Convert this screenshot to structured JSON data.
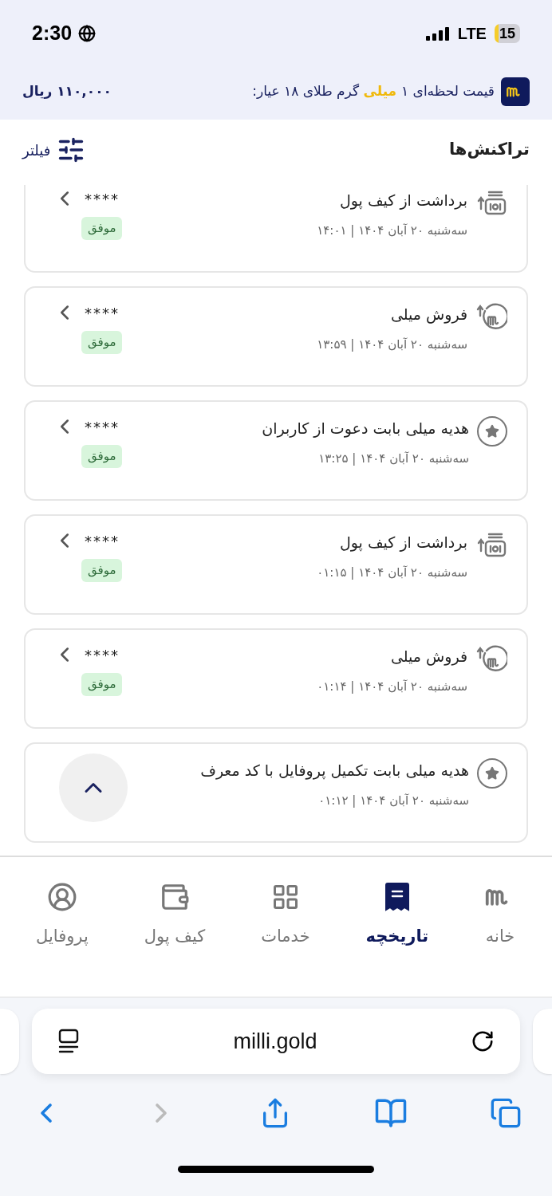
{
  "status_bar": {
    "time": "2:30",
    "network": "LTE",
    "battery": "15"
  },
  "price_banner": {
    "label_parts": [
      {
        "text": "قیمت لحظه‌ای ۱",
        "highlight": false
      },
      {
        "text": "میلی",
        "highlight": true
      },
      {
        "text": "گرم طلای ۱۸ عیار:",
        "highlight": false
      }
    ],
    "price": "۱۱۰,۰۰۰ ریال"
  },
  "header": {
    "title": "تراکنش‌ها",
    "filter": "فیلتر"
  },
  "transactions": [
    {
      "kind": "withdraw",
      "title": "برداشت از کیف پول",
      "date": "سه‌شنبه ۲۰ آبان ۱۴۰۴ | ۱۴:۰۱",
      "amount": "****",
      "status": "موفق"
    },
    {
      "kind": "sell",
      "title": "فروش میلی",
      "date": "سه‌شنبه ۲۰ آبان ۱۴۰۴ | ۱۳:۵۹",
      "amount": "****",
      "status": "موفق"
    },
    {
      "kind": "gift",
      "title": "هدیه میلی بابت دعوت از کاربران",
      "date": "سه‌شنبه ۲۰ آبان ۱۴۰۴ | ۱۳:۲۵",
      "amount": "****",
      "status": "موفق"
    },
    {
      "kind": "withdraw",
      "title": "برداشت از کیف پول",
      "date": "سه‌شنبه ۲۰ آبان ۱۴۰۴ | ۰۱:۱۵",
      "amount": "****",
      "status": "موفق"
    },
    {
      "kind": "sell",
      "title": "فروش میلی",
      "date": "سه‌شنبه ۲۰ آبان ۱۴۰۴ | ۰۱:۱۴",
      "amount": "****",
      "status": "موفق"
    },
    {
      "kind": "gift",
      "title": "هدیه میلی بابت تکمیل پروفایل با کد معرف",
      "date": "سه‌شنبه ۲۰ آبان ۱۴۰۴ | ۰۱:۱۲"
    }
  ],
  "bottom_nav": [
    {
      "kind": "home",
      "label": "خانه",
      "selected": false
    },
    {
      "kind": "history",
      "label": "تاریخچه",
      "selected": true
    },
    {
      "kind": "services",
      "label": "خدمات",
      "selected": false
    },
    {
      "kind": "wallet",
      "label": "کیف پول",
      "selected": false
    },
    {
      "kind": "profile",
      "label": "پروفایل",
      "selected": false
    }
  ],
  "browser": {
    "url": "milli.gold"
  }
}
